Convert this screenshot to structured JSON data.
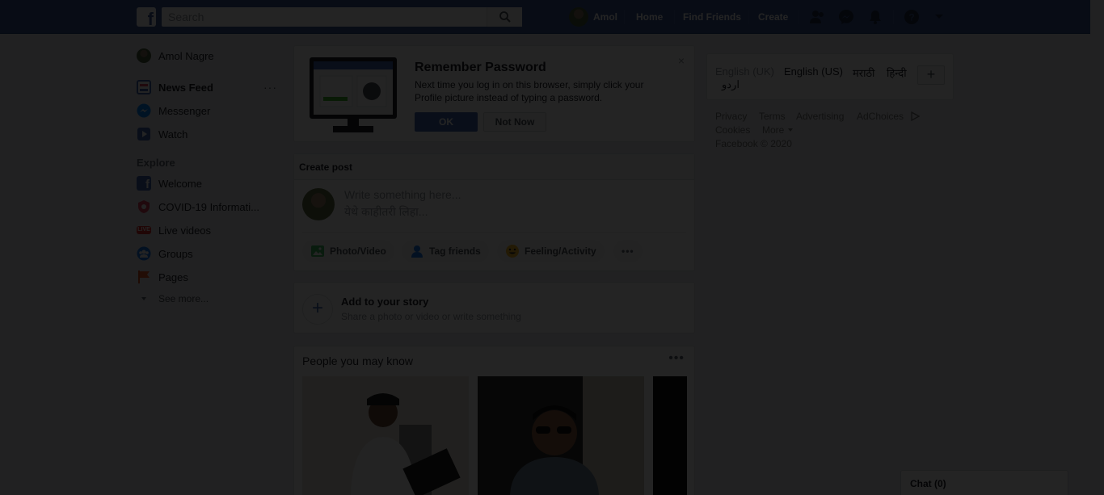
{
  "topbar": {
    "logo": "f",
    "search_placeholder": "Search",
    "profile_name": "Amol",
    "nav": [
      "Home",
      "Find Friends",
      "Create"
    ],
    "icons": [
      "friend-requests-icon",
      "messenger-icon",
      "notifications-icon",
      "help-icon",
      "account-menu-icon"
    ]
  },
  "sidebar": {
    "profile": "Amol Nagre",
    "items": [
      {
        "label": "News Feed",
        "icon": "news-feed-icon"
      },
      {
        "label": "Messenger",
        "icon": "messenger-icon"
      },
      {
        "label": "Watch",
        "icon": "watch-icon"
      }
    ],
    "more_dots": "···",
    "explore_heading": "Explore",
    "explore": [
      {
        "label": "Welcome",
        "icon": "welcome-icon"
      },
      {
        "label": "COVID-19 Informati...",
        "icon": "covid-info-icon"
      },
      {
        "label": "Live videos",
        "icon": "live-icon"
      },
      {
        "label": "Groups",
        "icon": "groups-icon"
      },
      {
        "label": "Pages",
        "icon": "pages-icon"
      }
    ],
    "see_more": "See more..."
  },
  "remember_password": {
    "title": "Remember Password",
    "text": "Next time you log in on this browser, simply click your Profile picture instead of typing a password.",
    "ok": "OK",
    "not_now": "Not Now",
    "close": "×"
  },
  "create_post": {
    "header": "Create post",
    "placeholder_en": "Write something here...",
    "placeholder_mr": "येथे काहीतरी लिहा...",
    "actions": [
      "Photo/Video",
      "Tag friends",
      "Feeling/Activity"
    ],
    "more": "•••"
  },
  "story": {
    "plus": "+",
    "title": "Add to your story",
    "subtitle": "Share a photo or video or write something"
  },
  "pymk": {
    "title": "People you may know",
    "dots": "•••"
  },
  "languages": {
    "items": [
      "English (UK)",
      "English (US)",
      "मराठी",
      "हिन्दी",
      "اردو"
    ],
    "add": "+"
  },
  "footer": {
    "links_row1": [
      "Privacy",
      "Terms",
      "Advertising",
      "AdChoices"
    ],
    "links_row2": [
      "Cookies",
      "More"
    ],
    "copyright": "Facebook © 2020"
  },
  "chat": {
    "label": "Chat (0)"
  },
  "colors": {
    "brand": "#3b5998",
    "button_primary": "#4267b2",
    "overlay": "rgba(0,0,0,0.86)"
  }
}
